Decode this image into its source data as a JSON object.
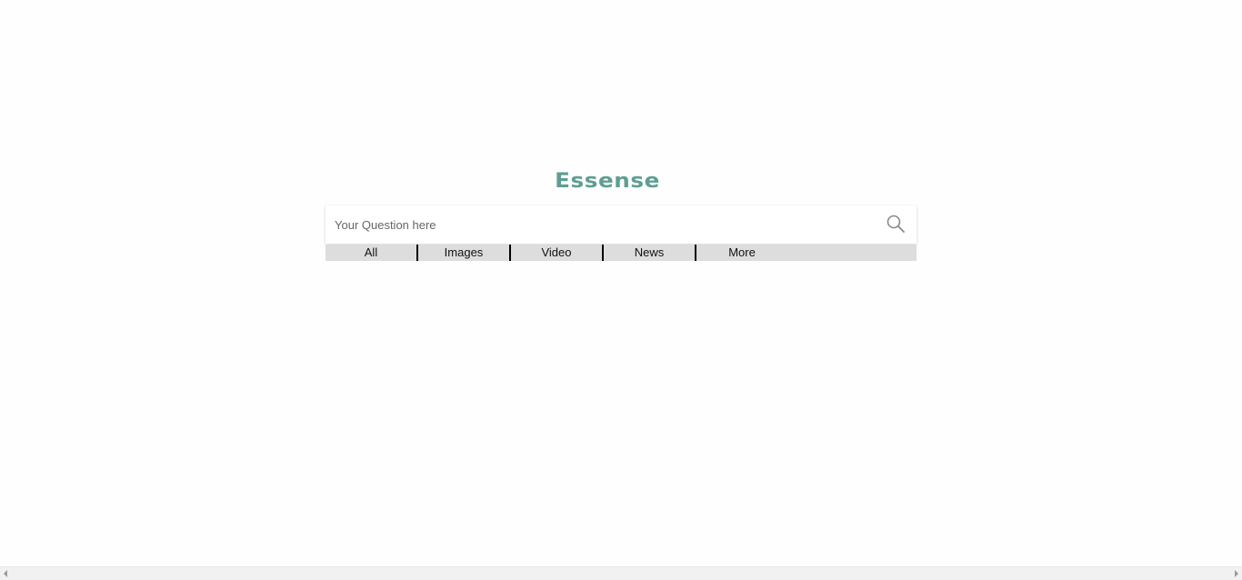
{
  "brand": {
    "name": "Essense",
    "color": "#5f9e92"
  },
  "search": {
    "placeholder": "Your Question here",
    "value": "",
    "icon": "search-icon"
  },
  "tabs": [
    {
      "label": "All"
    },
    {
      "label": "Images"
    },
    {
      "label": "Video"
    },
    {
      "label": "News"
    },
    {
      "label": "More"
    }
  ],
  "scrollbar": {
    "left_icon": "arrow-left-icon",
    "right_icon": "arrow-right-icon"
  }
}
